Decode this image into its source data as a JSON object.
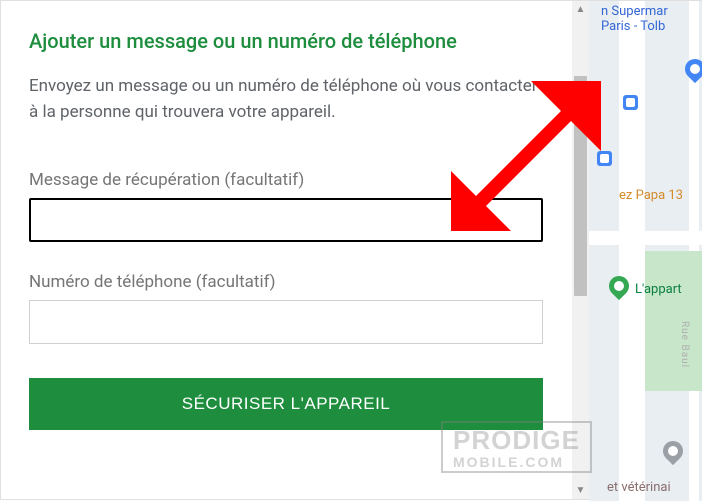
{
  "panel": {
    "title": "Ajouter un message ou un numéro de téléphone",
    "description": "Envoyez un message ou un numéro de téléphone où vous contacter à la personne qui trouvera votre appareil.",
    "recovery_message_label": "Message de récupération (facultatif)",
    "recovery_message_value": "",
    "phone_label": "Numéro de téléphone (facultatif)",
    "phone_value": "",
    "secure_button_label": "SÉCURISER L'APPAREIL"
  },
  "map": {
    "poi1_line1": "n Supermar",
    "poi1_line2": "Paris - Tolb",
    "poi2": "ez Papa 13",
    "poi3": "L'appart",
    "poi4": "et vétérinai",
    "street": "Rue Baul"
  },
  "watermark": {
    "line1": "PRODIGE",
    "line2": "MOBILE.COM"
  }
}
